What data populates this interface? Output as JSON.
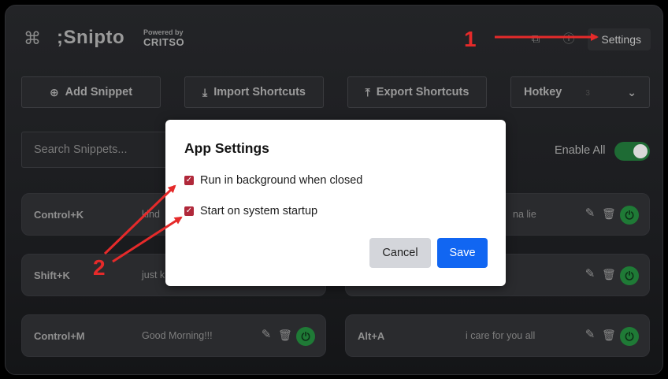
{
  "header": {
    "logo_icon": "command-icon",
    "app_name": ";Snipto",
    "powered_by": "Powered by",
    "company": "CRITSO",
    "settings_label": "Settings"
  },
  "toolbar": {
    "add_label": "Add Snippet",
    "import_label": "Import Shortcuts",
    "export_label": "Export Shortcuts",
    "hotkey_label": "Hotkey",
    "hotkey_value": "3"
  },
  "search": {
    "placeholder": "Search Snippets..."
  },
  "enable_all": {
    "label": "Enable All",
    "on": true
  },
  "snippets": [
    {
      "key": "Control+K",
      "text": "kind",
      "enabled": true
    },
    {
      "key": "",
      "text": "na lie",
      "enabled": true
    },
    {
      "key": "Shift+K",
      "text": "just k",
      "enabled": true
    },
    {
      "key": "",
      "text": "",
      "enabled": true
    },
    {
      "key": "Control+M",
      "text": "Good Morning!!!",
      "enabled": true
    },
    {
      "key": "Alt+A",
      "text": "i care for you all",
      "enabled": true
    }
  ],
  "modal": {
    "title": "App Settings",
    "options": [
      {
        "label": "Run in background when closed",
        "checked": true
      },
      {
        "label": "Start on system startup",
        "checked": true
      }
    ],
    "cancel_label": "Cancel",
    "save_label": "Save"
  },
  "annotations": {
    "one": "1",
    "two": "2",
    "color": "#e52a2a"
  }
}
